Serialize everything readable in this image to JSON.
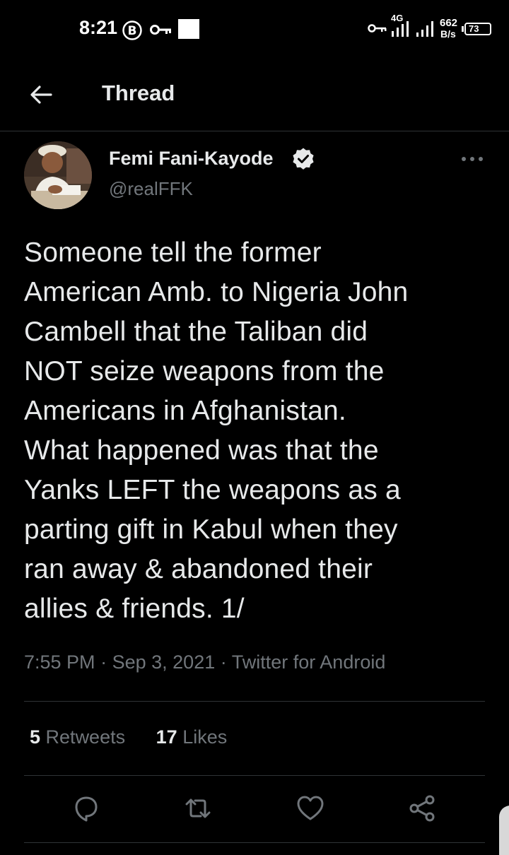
{
  "status_bar": {
    "time": "8:21",
    "network": "4G",
    "speed_value": "662",
    "speed_unit": "B/s",
    "battery": "73",
    "icons": [
      "b-badge-icon",
      "key-icon",
      "notification-square-icon",
      "vpn-key-icon",
      "signal-icon",
      "signal-icon",
      "battery-icon"
    ]
  },
  "header": {
    "title": "Thread",
    "back_icon": "arrow-left-icon"
  },
  "tweet": {
    "author_name": "Femi Fani-Kayode",
    "author_handle": "@realFFK",
    "verified_icon": "verified-badge-icon",
    "more_icon": "more-dots-icon",
    "text": "Someone tell the former\nAmerican Amb. to Nigeria John\nCambell that the Taliban did\nNOT seize weapons from the\nAmericans in Afghanistan.\nWhat happened was that the\nYanks LEFT the weapons as a\nparting gift in Kabul when they\nran away & abandoned their\nallies & friends. 1/",
    "time": "7:55 PM",
    "separator": "·",
    "date": "Sep 3, 2021",
    "source": "Twitter for Android"
  },
  "stats": {
    "retweets_count": "5",
    "retweets_label": "Retweets",
    "likes_count": "17",
    "likes_label": "Likes"
  },
  "actions": {
    "icons": [
      "reply-icon",
      "retweet-icon",
      "like-icon",
      "share-icon"
    ]
  },
  "colors": {
    "background": "#000000",
    "primary_text": "#e7e9ea",
    "secondary_text": "#71767b",
    "divider": "#2f3336"
  }
}
